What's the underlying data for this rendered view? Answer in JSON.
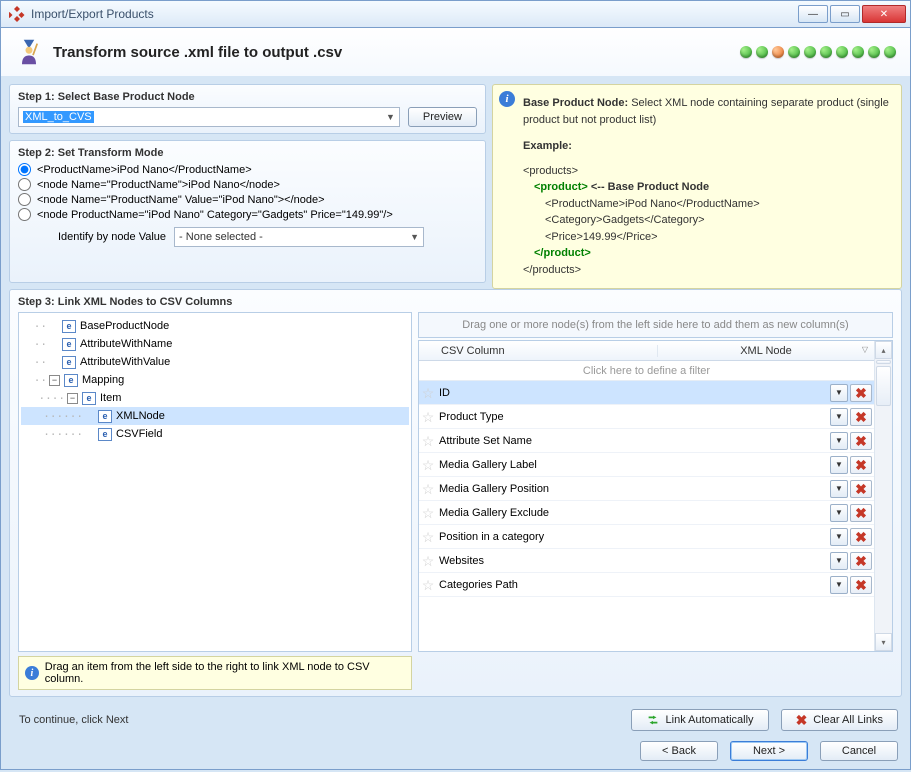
{
  "window": {
    "title": "Import/Export Products"
  },
  "header": {
    "title": "Transform source .xml file to output .csv"
  },
  "step1": {
    "title": "Step 1: Select Base Product Node",
    "selected": "XML_to_CVS",
    "preview_btn": "Preview"
  },
  "step2": {
    "title": "Step 2: Set Transform Mode",
    "options": [
      "<ProductName>iPod Nano</ProductName>",
      "<node Name=\"ProductName\">iPod Nano</node>",
      "<node Name=\"ProductName\" Value=\"iPod Nano\"></node>",
      "<node ProductName=\"iPod Nano\" Category=\"Gadgets\" Price=\"149.99\"/>"
    ],
    "identify_label": "Identify by node Value",
    "identify_value": "- None selected -"
  },
  "sidehelp": {
    "label": "Base Product Node:",
    "desc": "Select XML node containing separate product (single product but not product list)",
    "example_label": "Example:",
    "lines": {
      "l1": "<products>",
      "l2a": "<product>",
      "l2b": " <-- Base Product Node",
      "l3a": "<ProductName>iPod Nano</ProductName>",
      "l3b": "<Category>Gadgets</Category>",
      "l3c": "<Price>149.99</Price>",
      "l4": "</product>",
      "l5": "</products>"
    }
  },
  "step3": {
    "title": "Step 3: Link XML Nodes to CSV Columns",
    "tree": [
      {
        "label": "BaseProductNode",
        "depth": 1
      },
      {
        "label": "AttributeWithName",
        "depth": 1
      },
      {
        "label": "AttributeWithValue",
        "depth": 1
      },
      {
        "label": "Mapping",
        "depth": 1,
        "expander": true
      },
      {
        "label": "Item",
        "depth": 2,
        "expander": true
      },
      {
        "label": "XMLNode",
        "depth": 3,
        "selected": true
      },
      {
        "label": "CSVField",
        "depth": 3
      }
    ],
    "dropzone": "Drag one or more node(s) from the left side here to add them as new column(s)",
    "grid": {
      "col1": "CSV Column",
      "col2": "XML Node",
      "filter": "Click here to define a filter",
      "rows": [
        "ID",
        "Product Type",
        "Attribute Set Name",
        "Media Gallery Label",
        "Media Gallery Position",
        "Media Gallery Exclude",
        "Position in a category",
        "Websites",
        "Categories Path"
      ]
    },
    "hint": "Drag an item from the left side to the right to link XML node to CSV column."
  },
  "footer": {
    "continue": "To continue, click Next",
    "link_auto": "Link Automatically",
    "clear": "Clear All Links",
    "back": "< Back",
    "next": "Next >",
    "cancel": "Cancel"
  }
}
